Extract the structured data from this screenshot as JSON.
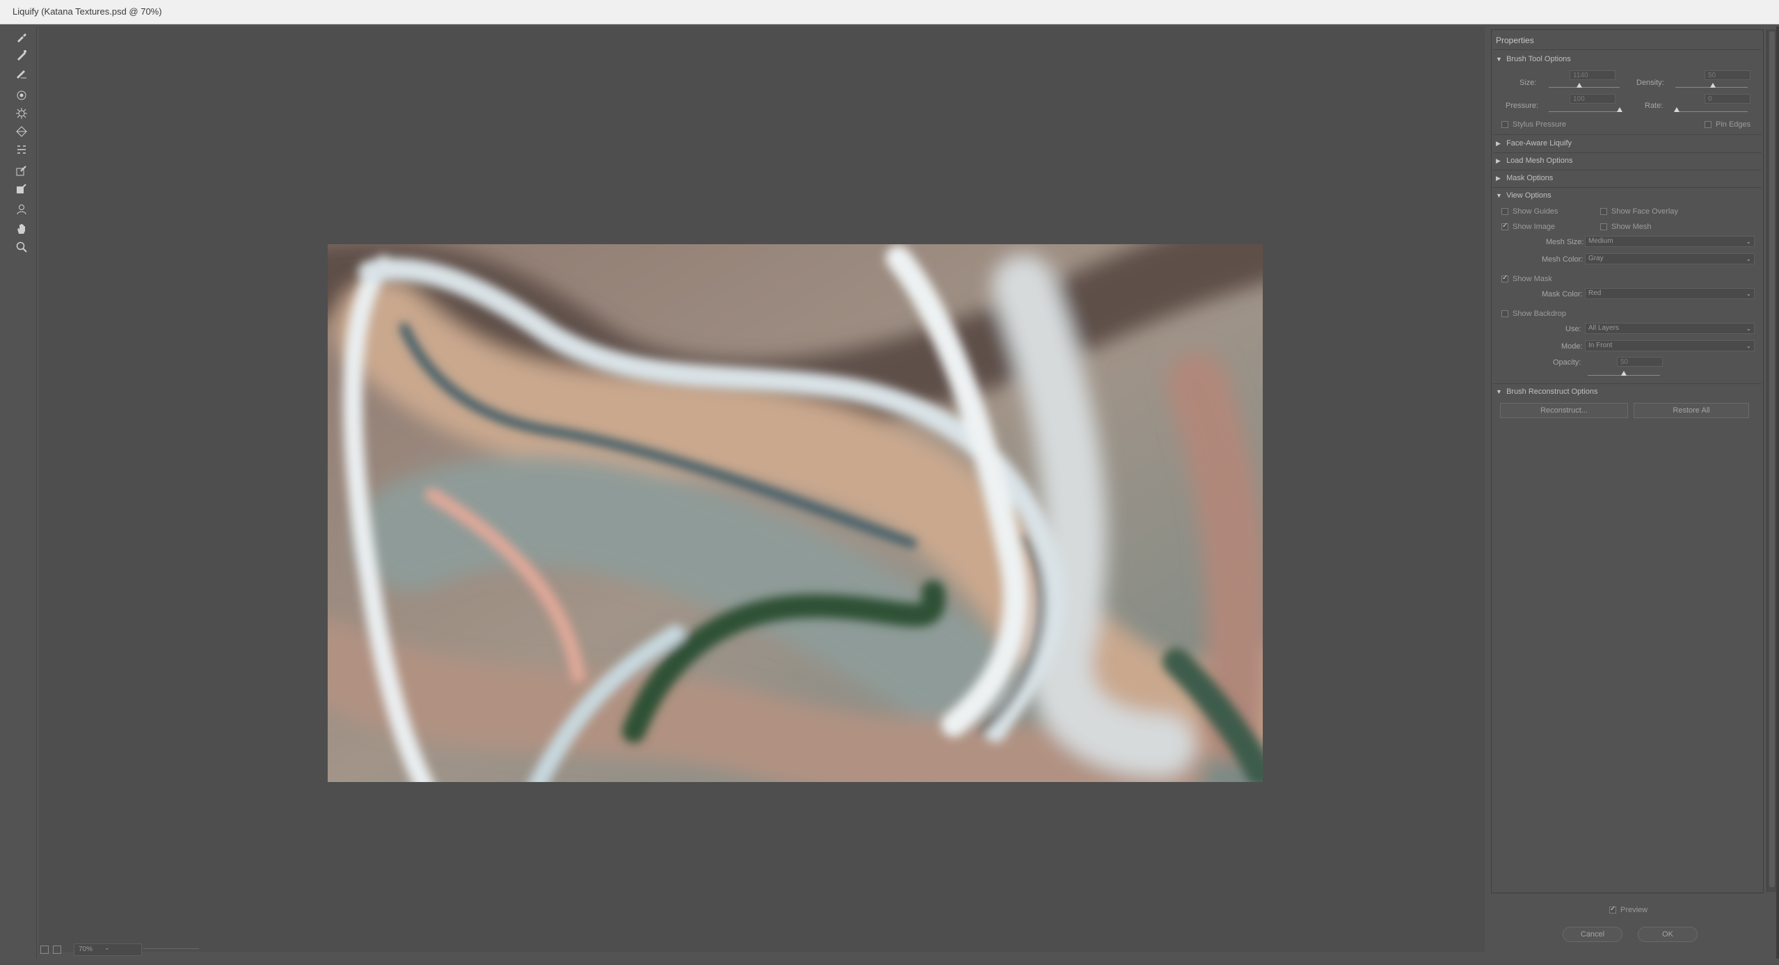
{
  "window": {
    "title": "Liquify (Katana Textures.psd @ 70%)"
  },
  "tools": [
    {
      "name": "forward-warp-tool-icon",
      "glyph": "✎"
    },
    {
      "name": "reconstruct-tool-icon",
      "glyph": "⟋"
    },
    {
      "name": "smooth-tool-icon",
      "glyph": "⟋"
    },
    {
      "name": "twirl-tool-icon",
      "glyph": "↻"
    },
    {
      "name": "pucker-tool-icon",
      "glyph": "✹"
    },
    {
      "name": "bloat-tool-icon",
      "glyph": "◇"
    },
    {
      "name": "push-left-tool-icon",
      "glyph": "⇶"
    },
    {
      "name": "freeze-mask-tool-icon",
      "glyph": "✐"
    },
    {
      "name": "thaw-mask-tool-icon",
      "glyph": "✐"
    },
    {
      "name": "face-tool-icon",
      "glyph": "☺"
    },
    {
      "name": "hand-tool-icon",
      "glyph": "✋"
    },
    {
      "name": "zoom-tool-icon",
      "glyph": "⌕"
    }
  ],
  "status": {
    "zoom": "70%"
  },
  "panel": {
    "title": "Properties",
    "brush_tool_options": {
      "heading": "Brush Tool Options",
      "size_label": "Size:",
      "size_value": "1140",
      "density_label": "Density:",
      "density_value": "50",
      "pressure_label": "Pressure:",
      "pressure_value": "100",
      "rate_label": "Rate:",
      "rate_value": "0",
      "stylus_pressure": "Stylus Pressure",
      "pin_edges": "Pin Edges"
    },
    "face_aware": "Face-Aware Liquify",
    "load_mesh": "Load Mesh Options",
    "mask_options": "Mask Options",
    "view_options": {
      "heading": "View Options",
      "show_guides": "Show Guides",
      "show_face_overlay": "Show Face Overlay",
      "show_image": "Show Image",
      "show_mesh": "Show Mesh",
      "mesh_size_label": "Mesh Size:",
      "mesh_size_value": "Medium",
      "mesh_color_label": "Mesh Color:",
      "mesh_color_value": "Gray",
      "show_mask": "Show Mask",
      "mask_color_label": "Mask Color:",
      "mask_color_value": "Red",
      "show_backdrop": "Show Backdrop",
      "use_label": "Use:",
      "use_value": "All Layers",
      "mode_label": "Mode:",
      "mode_value": "In Front",
      "opacity_label": "Opacity:",
      "opacity_value": "50"
    },
    "brush_reconstruct": {
      "heading": "Brush Reconstruct Options",
      "reconstruct": "Reconstruct...",
      "restore_all": "Restore All"
    },
    "preview": "Preview",
    "cancel": "Cancel",
    "ok": "OK"
  }
}
